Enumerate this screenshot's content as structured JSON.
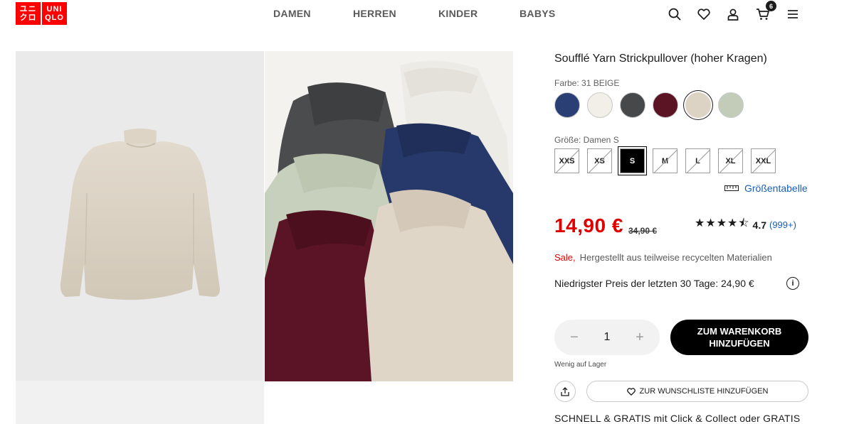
{
  "header": {
    "logo_top": "UNI",
    "logo_bottom": "QLO",
    "logo_kana_top": "ユニ",
    "logo_kana_bottom": "クロ",
    "nav": [
      "DAMEN",
      "HERREN",
      "KINDER",
      "BABYS"
    ],
    "cart_count": "6",
    "icons": [
      "search-icon",
      "heart-icon",
      "user-icon",
      "cart-icon",
      "menu-icon"
    ]
  },
  "product": {
    "title": "Soufflé Yarn Strickpullover (hoher Kragen)",
    "color_label": "Farbe: 31 BEIGE",
    "colors": [
      {
        "name": "navy",
        "hex": "#2a3f73"
      },
      {
        "name": "off-white",
        "hex": "#f1efe8"
      },
      {
        "name": "dark-gray",
        "hex": "#47484a"
      },
      {
        "name": "wine",
        "hex": "#5b1424"
      },
      {
        "name": "beige",
        "hex": "#ddd3c5",
        "selected": true
      },
      {
        "name": "sage",
        "hex": "#c3cbb9"
      }
    ],
    "size_label": "Größe: Damen S",
    "sizes": [
      {
        "label": "XXS",
        "available": false
      },
      {
        "label": "XS",
        "available": false
      },
      {
        "label": "S",
        "selected": true
      },
      {
        "label": "M",
        "available": false
      },
      {
        "label": "L",
        "available": false
      },
      {
        "label": "XL",
        "available": false
      },
      {
        "label": "XXL",
        "available": false
      }
    ],
    "size_chart": "Größentabelle",
    "price": "14,90 €",
    "old_price": "34,90 €",
    "rating_stars": "★★★★⯪",
    "rating_score": "4.7",
    "rating_count": "(999+)",
    "sale": "Sale,",
    "material": "Hergestellt aus teilweise recycelten Materialien",
    "lowest_price": "Niedrigster Preis der letzten 30 Tage: 24,90 €",
    "quantity": "1",
    "minus": "−",
    "plus": "+",
    "add_to_cart": "ZUM WARENKORB HINZUFÜGEN",
    "stock": "Wenig auf Lager",
    "wishlist": "ZUR WUNSCHLISTE HINZUFÜGEN",
    "shipping": "SCHNELL & GRATIS mit Click & Collect oder GRATIS"
  },
  "colors": {
    "brand_red": "#ff0000",
    "price_red": "#e00000",
    "link_blue": "#1a5fb4"
  }
}
